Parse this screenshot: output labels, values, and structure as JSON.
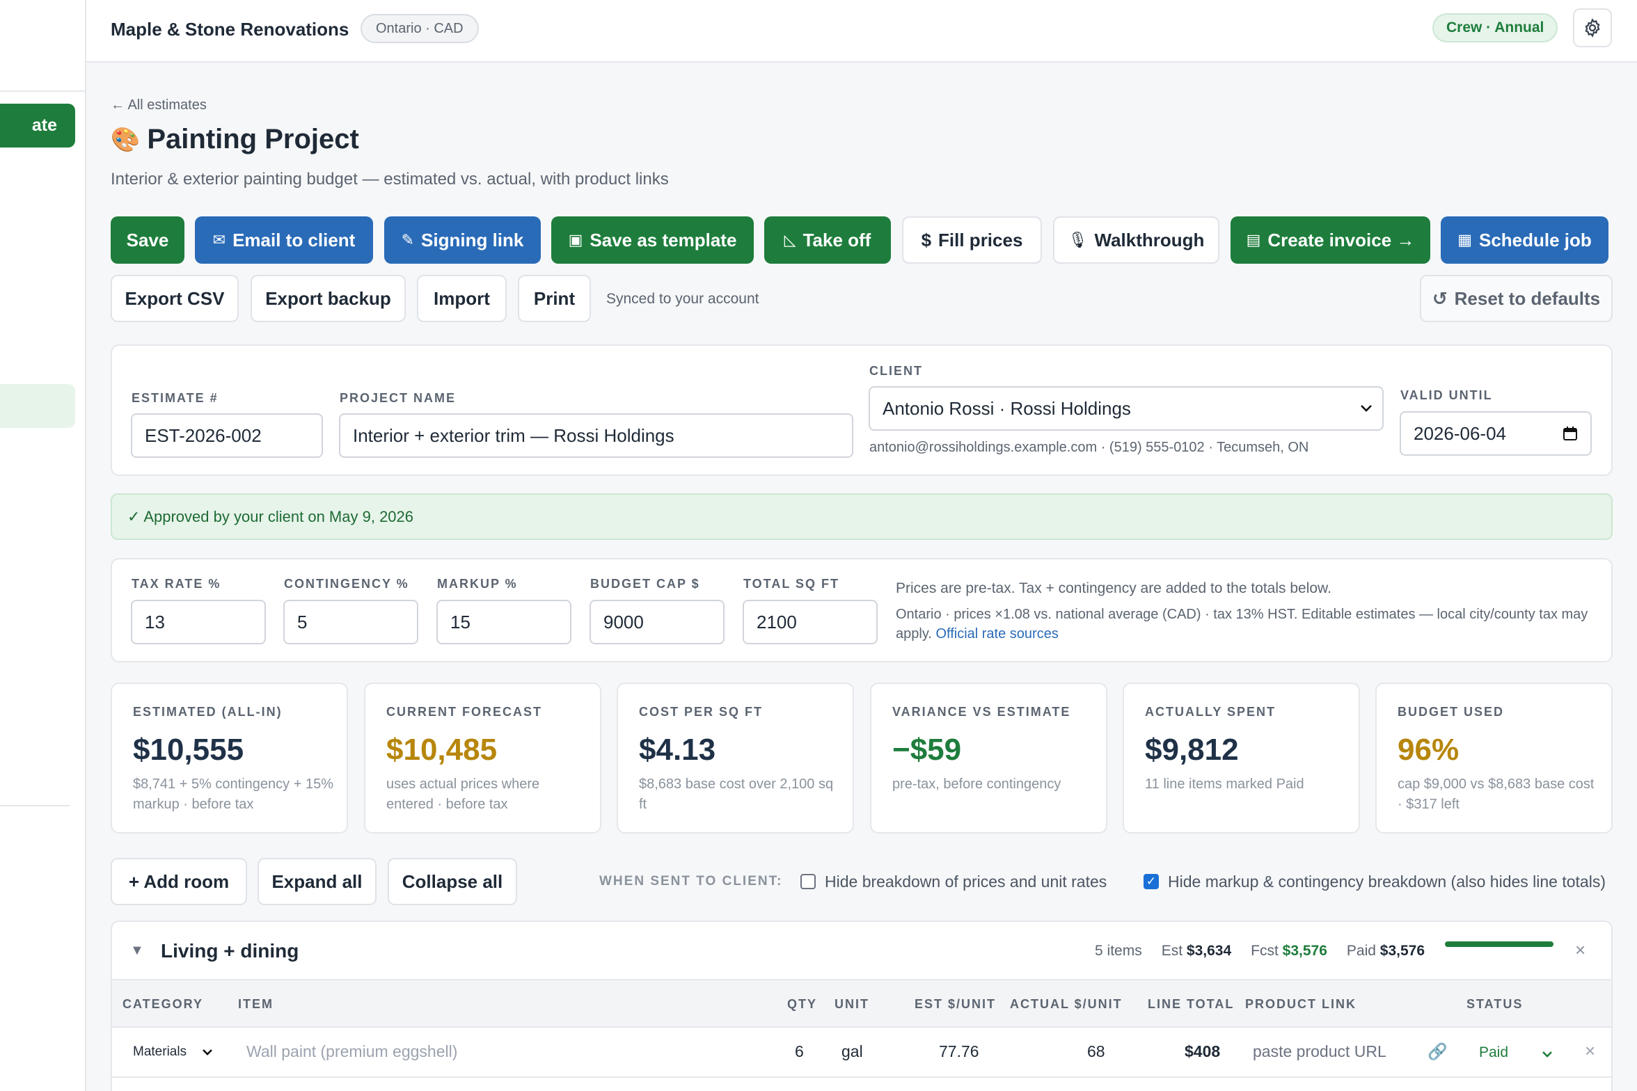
{
  "sidebar": {
    "new_label": "ate"
  },
  "topbar": {
    "brand": "Maple & Stone Renovations",
    "region": "Ontario · CAD",
    "plan": "Crew · Annual"
  },
  "header": {
    "back": "← All estimates",
    "title_emoji": "🎨",
    "title": "Painting Project",
    "subtitle": "Interior & exterior painting budget — estimated vs. actual, with product links"
  },
  "actions": {
    "save": "Save",
    "email": "Email to client",
    "signing": "Signing link",
    "template": "Save as template",
    "takeoff": "Take off",
    "fill": "Fill prices",
    "walkthrough": "Walkthrough",
    "invoice": "Create invoice →",
    "schedule": "Schedule job",
    "export_csv": "Export CSV",
    "export_backup": "Export backup",
    "import": "Import",
    "print": "Print",
    "synced": "Synced to your account",
    "reset": "Reset to defaults"
  },
  "details": {
    "estimate_label": "ESTIMATE #",
    "estimate_value": "EST-2026-002",
    "project_label": "PROJECT NAME",
    "project_value": "Interior + exterior trim — Rossi Holdings",
    "client_label": "CLIENT",
    "client_value": "Antonio Rossi · Rossi Holdings",
    "client_meta": "antonio@rossiholdings.example.com · (519) 555-0102 · Tecumseh, ON",
    "valid_label": "VALID UNTIL",
    "valid_value": "2026-06-04"
  },
  "approved": "✓ Approved by your client on May 9, 2026",
  "rates": {
    "tax_label": "TAX RATE %",
    "tax_value": "13",
    "cont_label": "CONTINGENCY %",
    "cont_value": "5",
    "markup_label": "MARKUP %",
    "markup_value": "15",
    "cap_label": "BUDGET CAP $",
    "cap_value": "9000",
    "sqft_label": "TOTAL SQ FT",
    "sqft_value": "2100",
    "note": "Prices are pre-tax. Tax + contingency are added to the totals below.",
    "note2": "Ontario · prices ×1.08 vs. national average (CAD) · tax 13% HST. Editable estimates — local city/county tax may apply.",
    "link": "Official rate sources"
  },
  "stats": [
    {
      "label": "ESTIMATED (ALL-IN)",
      "value": "$10,555",
      "sub": "$8,741 + 5% contingency + 15% markup · before tax",
      "color": "#1f3147"
    },
    {
      "label": "CURRENT FORECAST",
      "value": "$10,485",
      "sub": "uses actual prices where entered · before tax",
      "color": "#b7860b"
    },
    {
      "label": "COST PER SQ FT",
      "value": "$4.13",
      "sub": "$8,683 base cost over 2,100 sq ft",
      "color": "#1f3147"
    },
    {
      "label": "VARIANCE VS ESTIMATE",
      "value": "−$59",
      "sub": "pre-tax, before contingency",
      "color": "#1e7d3c"
    },
    {
      "label": "ACTUALLY SPENT",
      "value": "$9,812",
      "sub": "11 line items marked Paid",
      "color": "#1f3147"
    },
    {
      "label": "BUDGET USED",
      "value": "96%",
      "sub": "cap $9,000 vs $8,683 base cost · $317 left",
      "color": "#b7860b"
    }
  ],
  "room_controls": {
    "add": "+ Add room",
    "expand": "Expand all",
    "collapse": "Collapse all",
    "when_sent": "WHEN SENT TO CLIENT:",
    "hide_prices": "Hide breakdown of prices and unit rates",
    "hide_markup": "Hide markup & contingency breakdown (also hides line totals)"
  },
  "room": {
    "name": "Living + dining",
    "items": "5 items",
    "est_label": "Est",
    "est_value": "$3,634",
    "fcst_label": "Fcst",
    "fcst_value": "$3,576",
    "paid_label": "Paid",
    "paid_value": "$3,576",
    "paid_fraction": 1.0,
    "columns": [
      "CATEGORY",
      "ITEM",
      "QTY",
      "UNIT",
      "EST $/UNIT",
      "ACTUAL $/UNIT",
      "LINE TOTAL",
      "PRODUCT LINK",
      "STATUS"
    ],
    "rows": [
      {
        "category": "Materials",
        "item": "Wall paint (premium eggshell)",
        "qty": "6",
        "unit": "gal",
        "est": "77.76",
        "actual": "68",
        "total": "$408",
        "link": "paste product URL",
        "status": "Paid"
      }
    ]
  }
}
